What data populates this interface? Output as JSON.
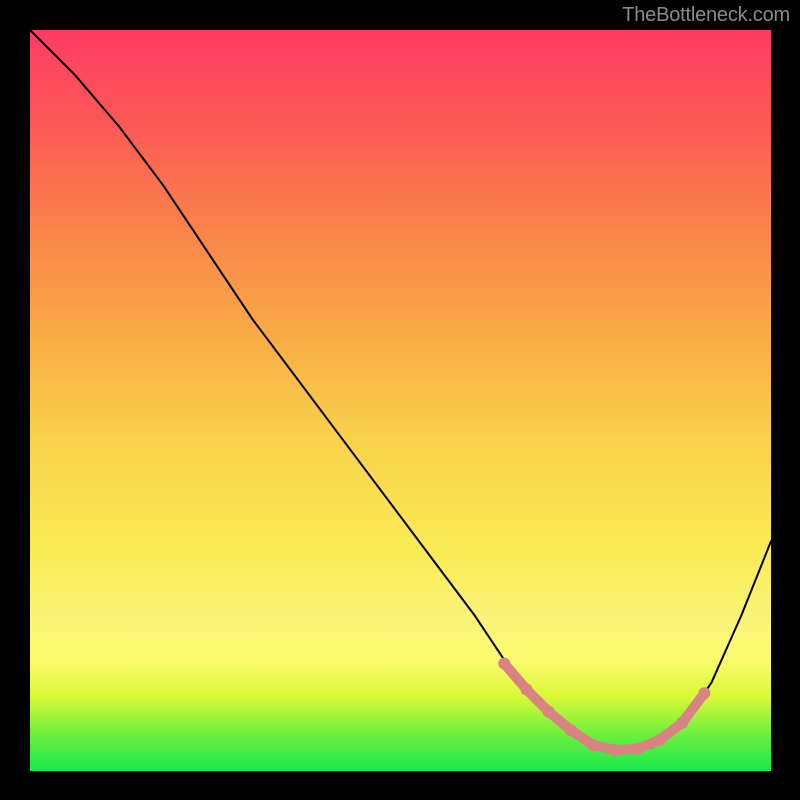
{
  "watermark": "TheBottleneck.com",
  "chart_data": {
    "type": "line",
    "title": "",
    "xlabel": "",
    "ylabel": "",
    "xlim": [
      0,
      100
    ],
    "ylim": [
      0,
      100
    ],
    "curve": {
      "name": "black-curve",
      "color": "#000000",
      "stroke_width": 2,
      "x": [
        0,
        6,
        12,
        18,
        24,
        30,
        36,
        42,
        48,
        54,
        60,
        64,
        68,
        72,
        76,
        80,
        84,
        88,
        92,
        96,
        100
      ],
      "y": [
        100,
        94,
        87,
        79,
        70,
        61,
        53,
        45,
        37,
        29,
        21,
        15,
        10,
        6,
        3.2,
        2.8,
        3.2,
        6,
        12,
        21,
        31
      ]
    },
    "highlight": {
      "name": "pink-marker-run",
      "color": "#d98383",
      "marker_radius": 6,
      "stroke_width": 10,
      "x": [
        64,
        67,
        70,
        73,
        76,
        79,
        82,
        85,
        88,
        91
      ],
      "y": [
        14.5,
        11,
        8,
        5.5,
        3.5,
        2.8,
        3.0,
        4.2,
        6.5,
        10.5
      ]
    }
  }
}
